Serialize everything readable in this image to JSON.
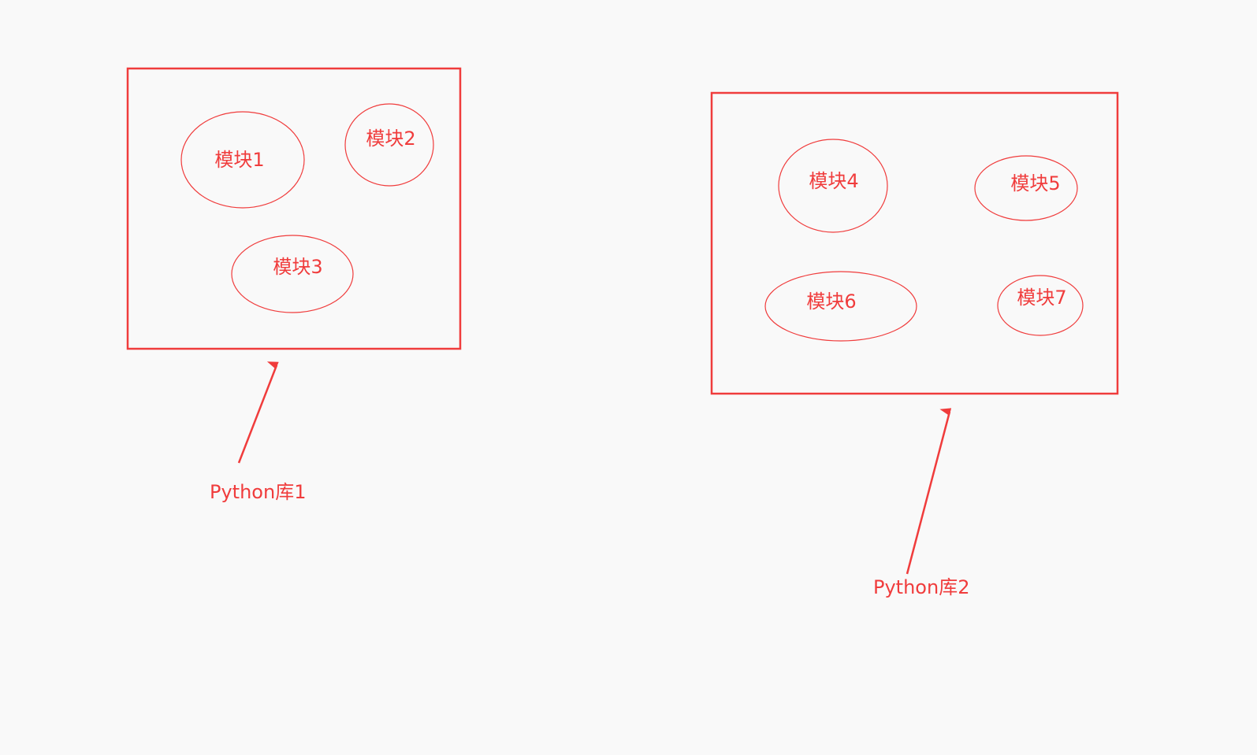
{
  "colors": {
    "background": "#f9f9f9",
    "stroke": "#f03c3c",
    "text": "#f03c3c"
  },
  "libraries": [
    {
      "label": "Python库1",
      "modules": [
        "模块1",
        "模块2",
        "模块3"
      ]
    },
    {
      "label": "Python库2",
      "modules": [
        "模块4",
        "模块5",
        "模块6",
        "模块7"
      ]
    }
  ]
}
